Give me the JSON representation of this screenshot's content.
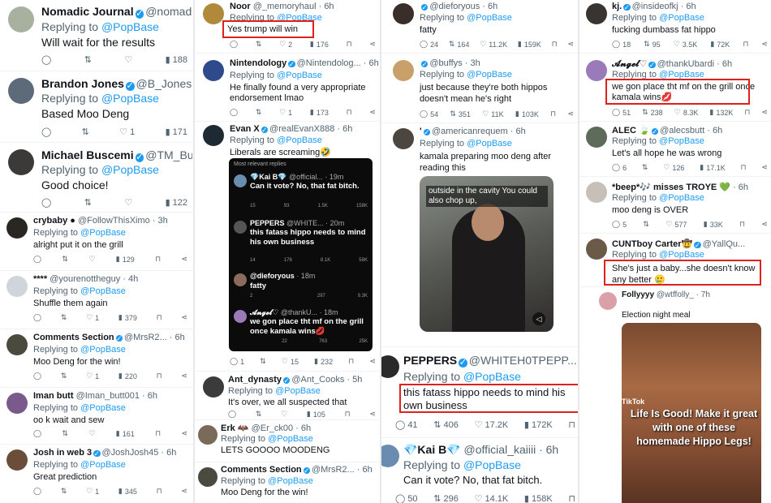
{
  "colors": {
    "verified": "#1d9bf0",
    "link": "#1d9bf0",
    "highlight": "#e0201a",
    "secondary": "#536471"
  },
  "col1": [
    {
      "name": "Nomadic Journal",
      "handle": "@nomadicj...",
      "time": "",
      "replying": "Replying to",
      "mention": "@PopBase",
      "text": "Will wait for the results",
      "reply": "",
      "rt": "",
      "like": "",
      "views": "188"
    },
    {
      "name": "Brandon Jones",
      "handle": "@B_Jones20...",
      "time": "",
      "replying": "Replying to",
      "mention": "@PopBase",
      "text": "Based Moo Deng",
      "reply": "",
      "rt": "",
      "like": "1",
      "views": "171"
    },
    {
      "name": "Michael Buscemi",
      "handle": "@TM_Busc...",
      "time": "",
      "replying": "Replying to",
      "mention": "@PopBase",
      "text": "Good choice!",
      "reply": "",
      "rt": "",
      "like": "",
      "views": "122"
    },
    {
      "name": "crybaby",
      "handle": "@FollowThisXimo · 3h",
      "replying": "Replying to",
      "mention": "@PopBase",
      "text": "alright put it on the grill",
      "reply": "",
      "rt": "",
      "like": "",
      "views": "129"
    },
    {
      "name": "****",
      "handle": "@yourenottheguy · 4h",
      "replying": "Replying to",
      "mention": "@PopBase",
      "text": "Shuffle them again",
      "reply": "",
      "rt": "",
      "like": "1",
      "views": "379"
    },
    {
      "name": "Comments Section",
      "handle": "@MrsR2... · 6h",
      "replying": "Replying to",
      "mention": "@PopBase",
      "text": "Moo Deng for the win!",
      "reply": "",
      "rt": "",
      "like": "1",
      "views": "220"
    },
    {
      "name": "Iman butt",
      "handle": "@Iman_butt001 · 6h",
      "replying": "Replying to",
      "mention": "@PopBase",
      "text": "oo k wait and sew",
      "reply": "",
      "rt": "",
      "like": "",
      "views": "161"
    },
    {
      "name": "Josh in web 3",
      "handle": "@JoshJosh45 · 6h",
      "replying": "Replying to",
      "mention": "@PopBase",
      "text": "Great prediction",
      "reply": "",
      "rt": "",
      "like": "1",
      "views": "345"
    }
  ],
  "col2": [
    {
      "name": "Noor",
      "handle": "@_memoryhaul · 6h",
      "replying": "Replying to",
      "mention": "@PopBase",
      "text": "Yes trump will win",
      "reply": "",
      "rt": "",
      "like": "2",
      "views": "176"
    },
    {
      "name": "Nintendology",
      "handle": "@Nintendolog... · 6h",
      "replying": "Replying to",
      "mention": "@PopBase",
      "text": "He finally found a very appropriate endorsement lmao",
      "reply": "",
      "rt": "",
      "like": "1",
      "views": "173"
    },
    {
      "name": "Evan X",
      "handle": "@realEvanX888 · 6h",
      "replying": "Replying to",
      "mention": "@PopBase",
      "text": "Liberals are screaming🤣",
      "reply": "1",
      "rt": "",
      "like": "15",
      "views": "232"
    },
    {
      "name": "Ant_dynasty",
      "handle": "@Ant_Cooks · 5h",
      "replying": "Replying to",
      "mention": "@PopBase",
      "text": "It's over, we all suspected that",
      "reply": "",
      "rt": "",
      "like": "",
      "views": "105"
    },
    {
      "name": "Erk 🦇",
      "handle": "@Er_ck00 · 6h",
      "replying": "Replying to",
      "mention": "@PopBase",
      "text": "LETS GOOOO MOODENG"
    },
    {
      "name": "Comments Section",
      "handle": "@MrsR2... · 6h",
      "replying": "Replying to",
      "mention": "@PopBase",
      "text": "Moo Deng for the win!"
    }
  ],
  "embed": {
    "header": "Most relevant replies",
    "items": [
      {
        "name": "💎Kai B💎",
        "handle": "@official... · 19m",
        "text": "Can it vote? No, that fat bitch.",
        "stats": [
          "15",
          "93",
          "1.5K",
          "158K"
        ]
      },
      {
        "name": "PEPPERS",
        "handle": "@WHITE... · 20m",
        "text": "this fatass hippo needs to mind his own business",
        "stats": [
          "14",
          "176",
          "8.1K",
          "58K"
        ]
      },
      {
        "name": "@dieforyous",
        "handle": "· 18m",
        "text": "fatty",
        "stats": [
          "2",
          "",
          "297",
          "9.3K"
        ]
      },
      {
        "name": "𝓐𝓷𝓰𝓮𝓵♡",
        "handle": "@thankU... · 18m",
        "text": "we gon place tht mf on the grill once kamala wins💋",
        "stats": [
          "",
          "22",
          "763",
          "25K"
        ]
      }
    ]
  },
  "col3": [
    {
      "name": "",
      "handle": "@dieforyous · 6h",
      "replying": "Replying to",
      "mention": "@PopBase",
      "text": "fatty",
      "reply": "24",
      "rt": "164",
      "like": "11.2K",
      "views": "159K"
    },
    {
      "name": "",
      "handle": "@buffys · 3h",
      "replying": "Replying to",
      "mention": "@PopBase",
      "text": "just because they're both hippos doesn't mean he's right",
      "reply": "54",
      "rt": "351",
      "like": "11K",
      "views": "103K"
    },
    {
      "name": "'",
      "handle": "@americanrequem · 6h",
      "replying": "Replying to",
      "mention": "@PopBase",
      "text": "kamala preparing moo deng after reading this",
      "caption": "outside in the cavity You could also chop up,"
    },
    {
      "name": "PEPPERS",
      "handle": "@WHITEH0TPEPP... · 6h",
      "replying": "Replying to",
      "mention": "@PopBase",
      "text": "this fatass hippo needs to mind his own business",
      "reply": "41",
      "rt": "406",
      "like": "17.2K",
      "views": "172K"
    },
    {
      "name": "💎Kai B💎",
      "handle": "@official_kaiiii · 6h",
      "replying": "Replying to",
      "mention": "@PopBase",
      "text": "Can it vote? No, that fat bitch.",
      "reply": "50",
      "rt": "296",
      "like": "14.1K",
      "views": "158K"
    }
  ],
  "col4": [
    {
      "name": "kj.",
      "handle": "@insideofkj · 6h",
      "replying": "Replying to",
      "mention": "@PopBase",
      "text": "fucking dumbass fat hippo",
      "reply": "18",
      "rt": "95",
      "like": "3.5K",
      "views": "72K"
    },
    {
      "name": "𝓐𝓷𝓰𝓮𝓵♡",
      "handle": "@thankUbardi · 6h",
      "replying": "Replying to",
      "mention": "@PopBase",
      "text": "we gon place tht mf on the grill once kamala wins💋",
      "reply": "51",
      "rt": "238",
      "like": "8.3K",
      "views": "132K"
    },
    {
      "name": "ALEC 🍃",
      "handle": "@alecsbutt · 6h",
      "replying": "Replying to",
      "mention": "@PopBase",
      "text": "Let's all hope he was wrong",
      "reply": "6",
      "rt": "",
      "like": "126",
      "views": "17.1K"
    },
    {
      "name": "*beep*🎶 misses TROYE 💚",
      "handle": "· 6h",
      "replying": "Replying to",
      "mention": "@PopBase",
      "text": "moo deng is OVER",
      "reply": "5",
      "rt": "",
      "like": "577",
      "views": "33K"
    },
    {
      "name": "CUNTboy Carter🤠",
      "handle": "@YallQu...",
      "replying": "Replying to",
      "mention": "@PopBase",
      "text": "She's just a baby...she doesn't know any better 🥲",
      "reply": "",
      "rt": "",
      "like": "",
      "views": ""
    },
    {
      "name": "Follyyyy",
      "handle": "@wtffolly_ · 7h",
      "replying": "",
      "mention": "",
      "text": "Election night meal",
      "caption": "Life Is Good! Make it great with one of these homemade Hippo Legs!",
      "tiktok": "TikTok"
    }
  ]
}
